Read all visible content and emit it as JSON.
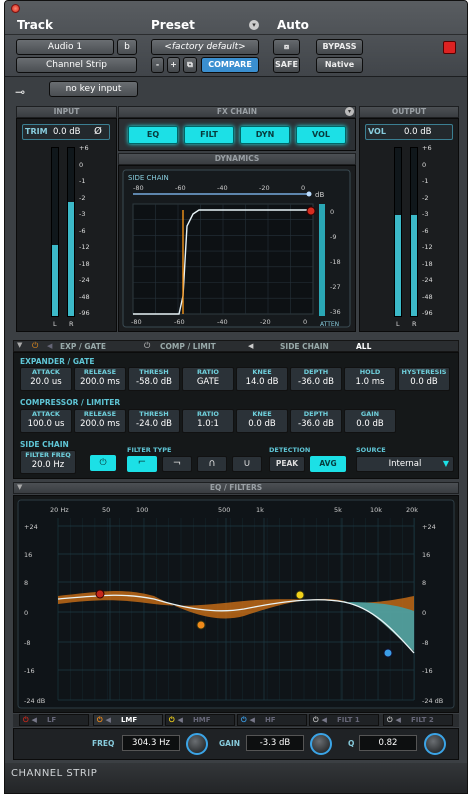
{
  "header": {
    "track_label": "Track",
    "preset_label": "Preset",
    "auto_label": "Auto",
    "track_name": "Audio 1",
    "track_variant": "b",
    "insert_name": "Channel Strip",
    "preset_name": "<factory default>",
    "minus": "-",
    "plus": "+",
    "compare": "COMPARE",
    "safe": "SAFE",
    "bypass": "BYPASS",
    "native": "Native",
    "key_input": "no key input"
  },
  "input": {
    "title": "INPUT",
    "trim_label": "TRIM",
    "trim_value": "0.0 dB",
    "phase": "Ø",
    "scale": [
      "+6",
      "0",
      "-1",
      "-2",
      "-3",
      "-6",
      "-12",
      "-18",
      "-24",
      "-48",
      "-96"
    ],
    "l": "L",
    "r": "R",
    "level_l": 0.42,
    "level_r": 0.68
  },
  "fxchain": {
    "title": "FX CHAIN",
    "buttons": [
      "EQ",
      "FILT",
      "DYN",
      "VOL"
    ]
  },
  "dynamics": {
    "title": "DYNAMICS",
    "sidechain_label": "SIDE CHAIN",
    "sc_scale": [
      "-80",
      "-60",
      "-40",
      "-20",
      "0"
    ],
    "db": "dB",
    "graph_x": [
      "-80",
      "-60",
      "-40",
      "-20",
      "0"
    ],
    "graph_y": [
      "0",
      "-9",
      "-18",
      "-27",
      "-36"
    ],
    "atten": "ATTEN"
  },
  "output": {
    "title": "OUTPUT",
    "vol_label": "VOL",
    "vol_value": "0.0 dB",
    "scale": [
      "+6",
      "0",
      "-1",
      "-2",
      "-3",
      "-6",
      "-12",
      "-18",
      "-24",
      "-48",
      "-96"
    ],
    "l": "L",
    "r": "R",
    "level_l": 0.6,
    "level_r": 0.6
  },
  "dyntabs": {
    "exp": "EXP / GATE",
    "comp": "COMP / LIMIT",
    "side": "SIDE CHAIN",
    "all": "ALL"
  },
  "expander": {
    "title": "EXPANDER / GATE",
    "params": [
      {
        "label": "ATTACK",
        "value": "20.0 us"
      },
      {
        "label": "RELEASE",
        "value": "200.0 ms"
      },
      {
        "label": "THRESH",
        "value": "-58.0 dB"
      },
      {
        "label": "RATIO",
        "value": "GATE"
      },
      {
        "label": "KNEE",
        "value": "14.0 dB"
      },
      {
        "label": "DEPTH",
        "value": "-36.0 dB"
      },
      {
        "label": "HOLD",
        "value": "1.0 ms"
      },
      {
        "label": "HYSTERESIS",
        "value": "0.0 dB"
      }
    ]
  },
  "compressor": {
    "title": "COMPRESSOR / LIMITER",
    "params": [
      {
        "label": "ATTACK",
        "value": "100.0 us"
      },
      {
        "label": "RELEASE",
        "value": "200.0 ms"
      },
      {
        "label": "THRESH",
        "value": "-24.0 dB"
      },
      {
        "label": "RATIO",
        "value": "1.0:1"
      },
      {
        "label": "KNEE",
        "value": "0.0 dB"
      },
      {
        "label": "DEPTH",
        "value": "-36.0 dB"
      },
      {
        "label": "GAIN",
        "value": "0.0 dB"
      }
    ]
  },
  "sidechain": {
    "title": "SIDE CHAIN",
    "freq_label": "FILTER FREQ",
    "freq_value": "20.0 Hz",
    "filter_type": "FILTER TYPE",
    "detection": "DETECTION",
    "peak": "PEAK",
    "avg": "AVG",
    "source": "SOURCE",
    "source_value": "Internal"
  },
  "eq": {
    "title": "EQ / FILTERS",
    "freq_ticks": [
      "20 Hz",
      "50",
      "100",
      "500",
      "1k",
      "5k",
      "10k",
      "20k"
    ],
    "db_left": [
      "+24",
      "16",
      "8",
      "0",
      "-8",
      "-16",
      "-24 dB"
    ],
    "db_right": [
      "+24",
      "16",
      "8",
      "0",
      "-8",
      "-16",
      "-24 dB"
    ],
    "bands": [
      "LF",
      "LMF",
      "HMF",
      "HF",
      "FILT 1",
      "FILT 2"
    ],
    "freq_label": "FREQ",
    "freq_value": "304.3 Hz",
    "gain_label": "GAIN",
    "gain_value": "-3.3 dB",
    "q_label": "Q",
    "q_value": "0.82"
  },
  "footer": {
    "title": "CHANNEL STRIP"
  }
}
